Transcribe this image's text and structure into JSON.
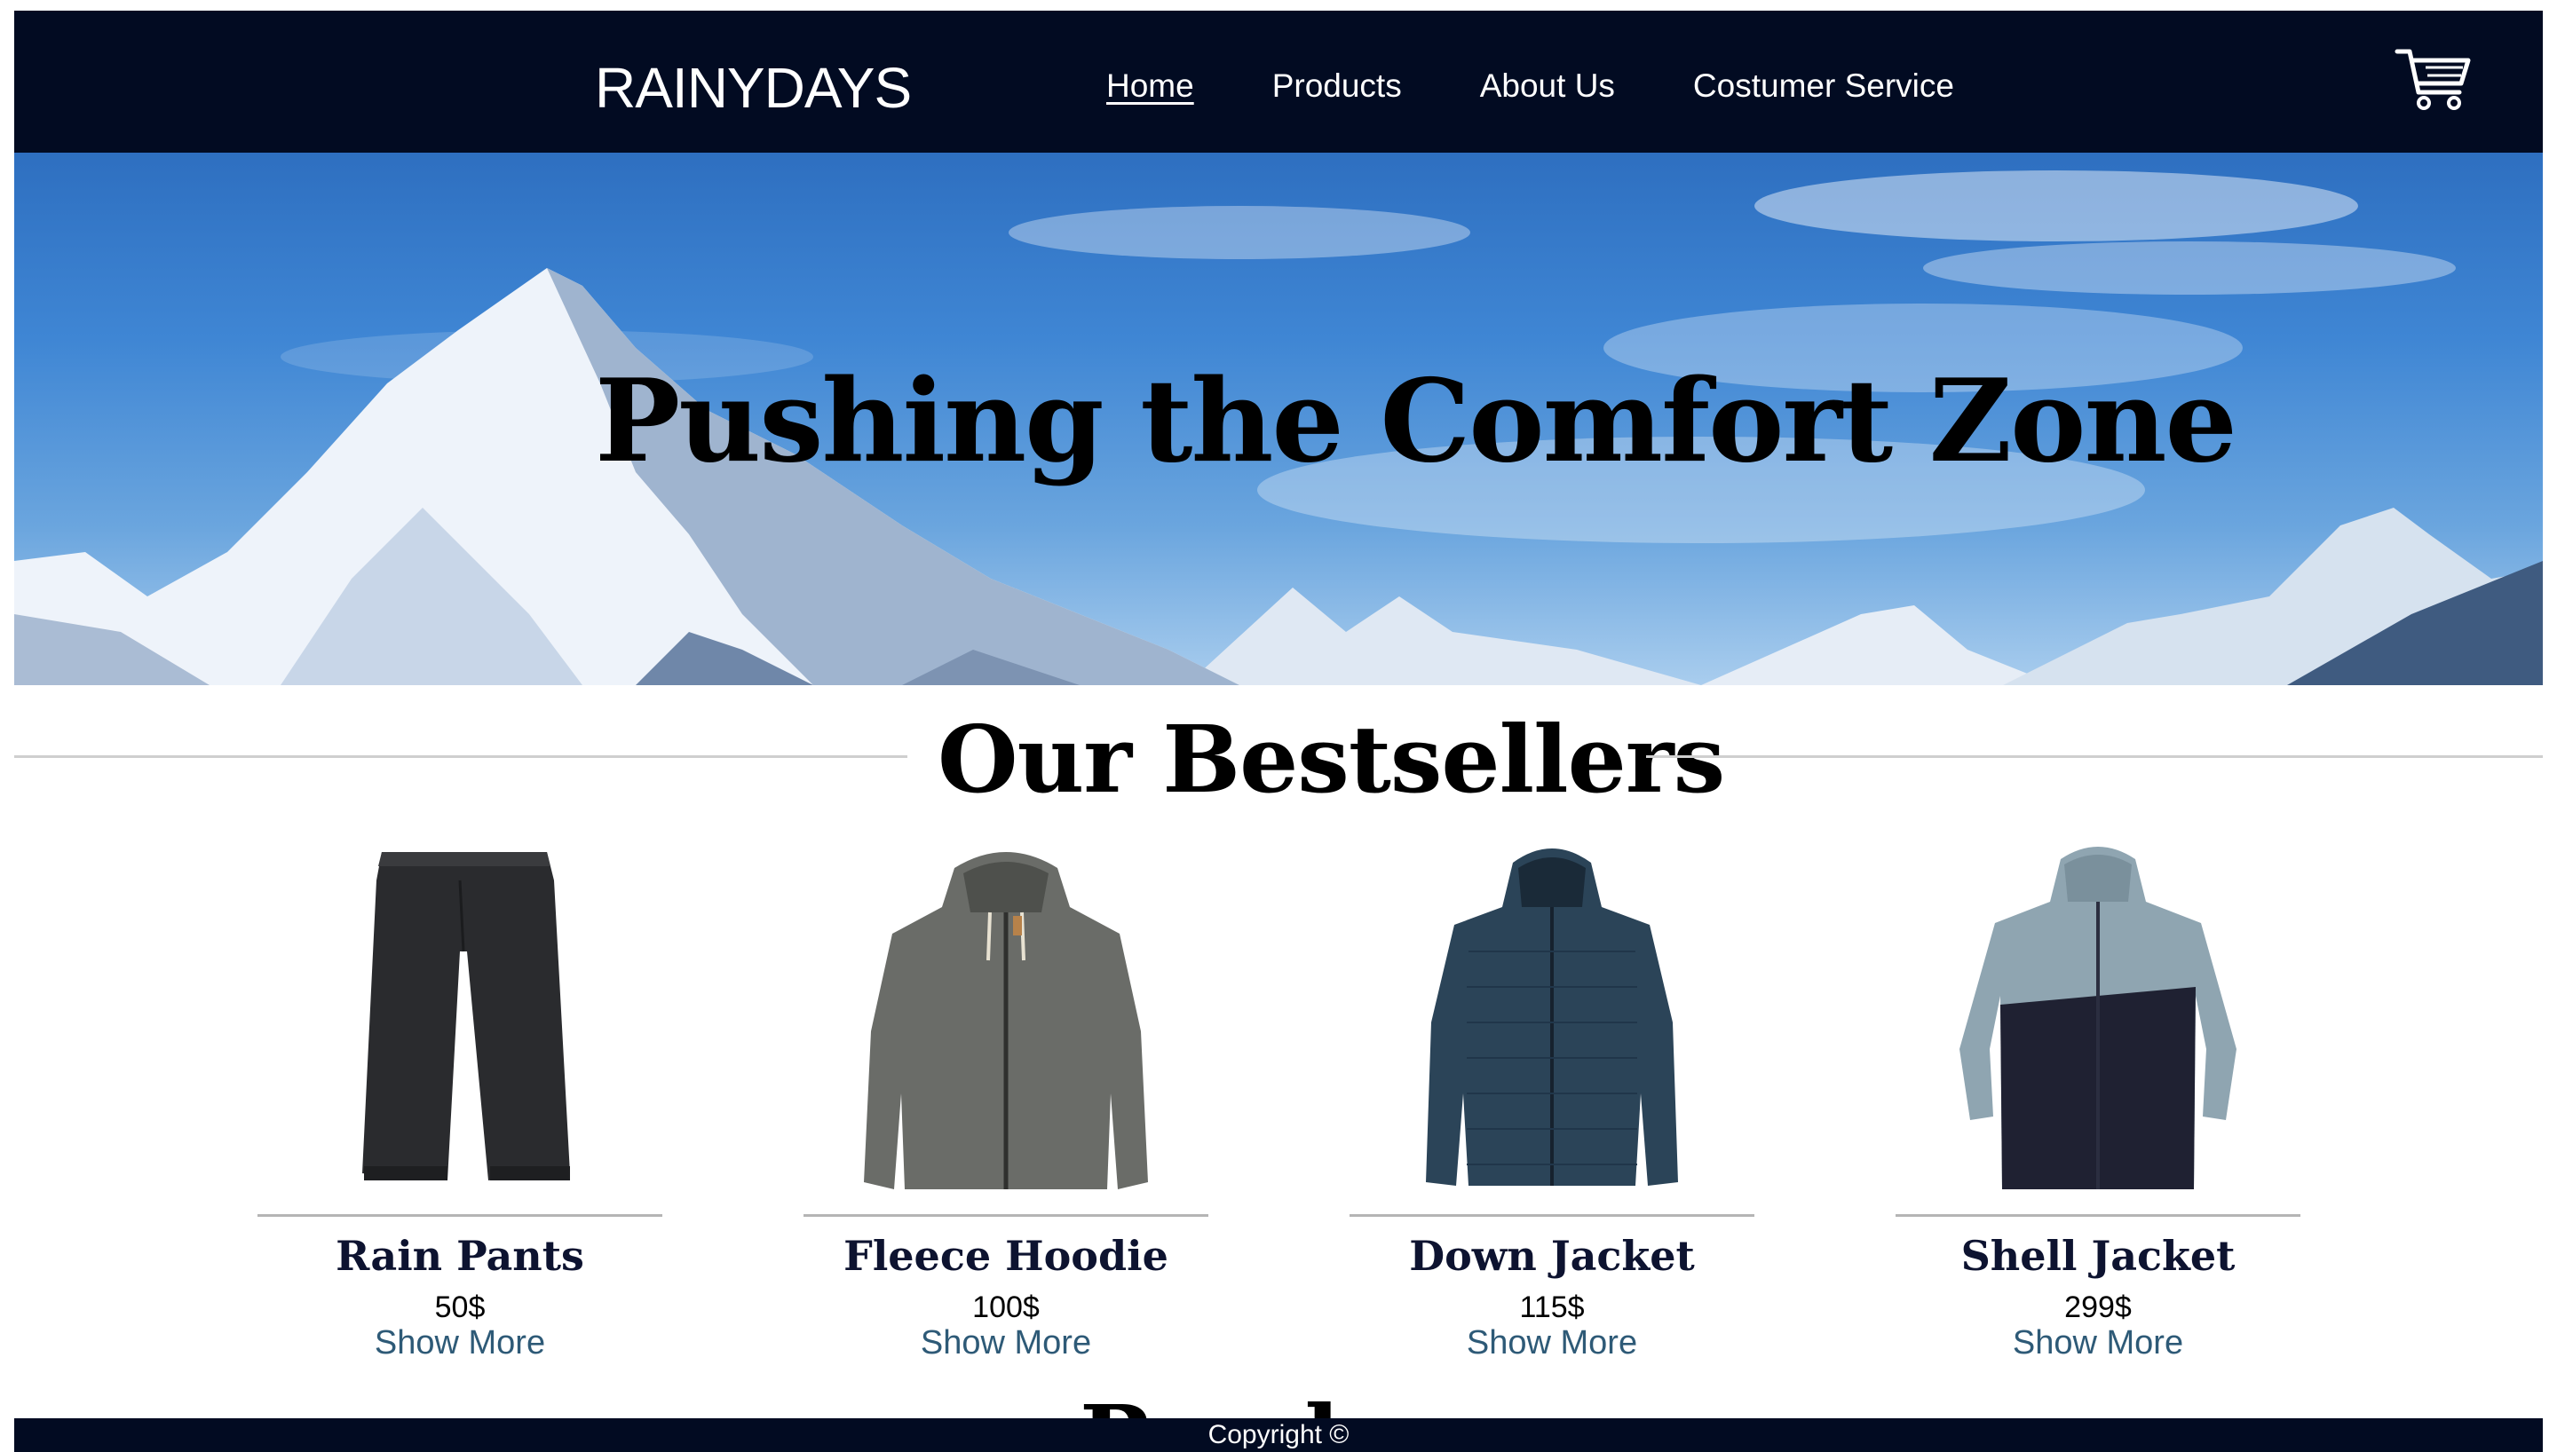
{
  "header": {
    "logo": "RAINYDAYS",
    "nav": [
      "Home",
      "Products",
      "About Us",
      "Costumer Service"
    ],
    "active_nav": "Home",
    "cart_icon": "cart-icon"
  },
  "hero": {
    "title": "Pushing the Comfort Zone"
  },
  "bestsellers": {
    "title": "Our Bestsellers",
    "products": [
      {
        "name": "Rain Pants",
        "price": "50$",
        "action": "Show More"
      },
      {
        "name": "Fleece Hoodie",
        "price": "100$",
        "action": "Show More"
      },
      {
        "name": "Down Jacket",
        "price": "115$",
        "action": "Show More"
      },
      {
        "name": "Shell Jacket",
        "price": "299$",
        "action": "Show More"
      }
    ]
  },
  "next_section_peek": "Read",
  "footer": {
    "copyright": "Copyright ©"
  },
  "colors": {
    "header_bg": "#020b22",
    "link": "#2e5a77",
    "product_name": "#0d1330"
  }
}
